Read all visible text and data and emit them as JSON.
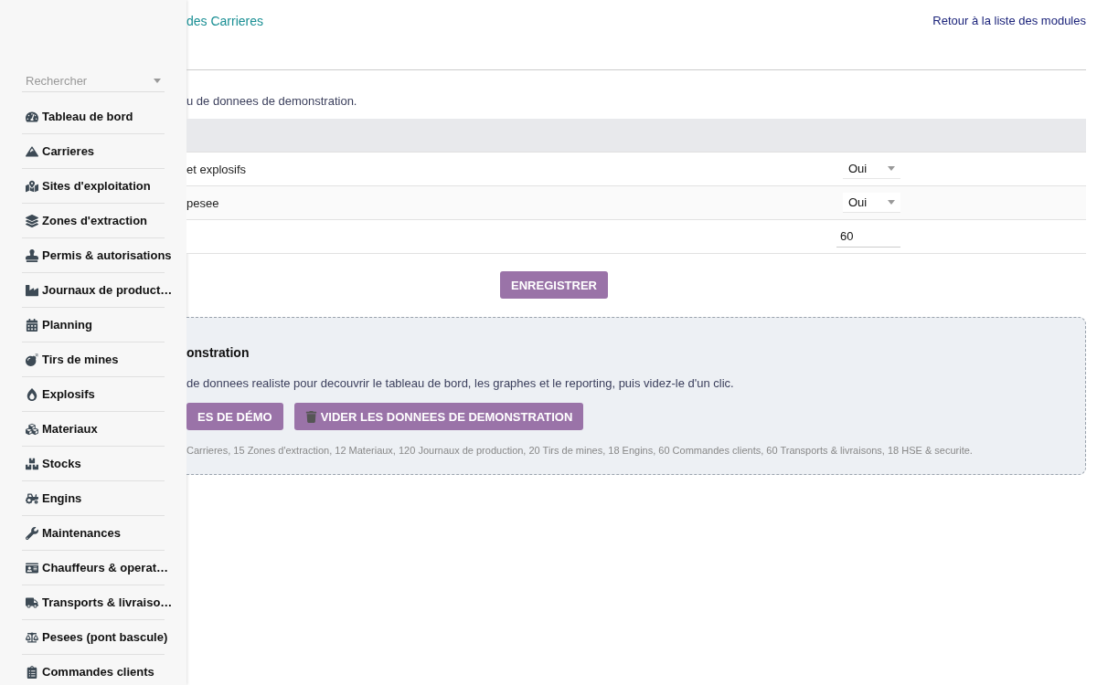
{
  "sidebar": {
    "search": {
      "placeholder": "Rechercher"
    },
    "items": [
      {
        "label": "Tableau de bord"
      },
      {
        "label": "Carrieres"
      },
      {
        "label": "Sites d'exploitation"
      },
      {
        "label": "Zones d'extraction"
      },
      {
        "label": "Permis & autorisations"
      },
      {
        "label": "Journaux de product…"
      },
      {
        "label": "Planning"
      },
      {
        "label": "Tirs de mines"
      },
      {
        "label": "Explosifs"
      },
      {
        "label": "Materiaux"
      },
      {
        "label": "Stocks"
      },
      {
        "label": "Engins"
      },
      {
        "label": "Maintenances"
      },
      {
        "label": "Chauffeurs & operat…"
      },
      {
        "label": "Transports & livraiso…"
      },
      {
        "label": "Pesees (pont bascule)"
      },
      {
        "label": "Commandes clients"
      }
    ]
  },
  "header": {
    "breadcrumb": "des Carrieres",
    "back_link": "Retour à la liste des modules"
  },
  "intro": "u de donnees de demonstration.",
  "settings": {
    "rows": [
      {
        "kind": "select",
        "label": "et explosifs",
        "value": "Oui"
      },
      {
        "kind": "select",
        "label": "pesee",
        "value": "Oui"
      },
      {
        "kind": "number",
        "label": "",
        "value": "60"
      }
    ],
    "save_button": "ENREGISTRER"
  },
  "demo": {
    "title": "onstration",
    "description": "de donnees realiste pour decouvrir le tableau de bord, les graphes et le reporting, puis videz-le d'un clic.",
    "buttons": [
      {
        "kind": "load",
        "label": "ES DE DÉMO"
      },
      {
        "kind": "clear",
        "label": "VIDER LES DONNEES DE DEMONSTRATION"
      }
    ],
    "note": "Carrieres, 15 Zones d'extraction, 12 Materiaux, 120 Journaux de production, 20 Tirs de mines, 18 Engins, 60 Commandes clients, 60 Transports & livraisons, 18 HSE & securite."
  }
}
